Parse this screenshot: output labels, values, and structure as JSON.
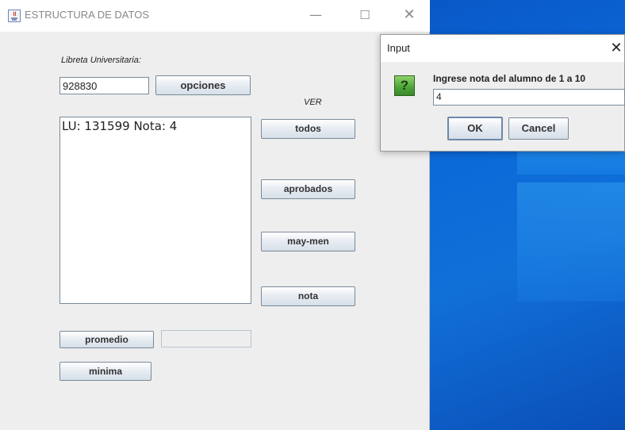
{
  "window": {
    "title": "ESTRUCTURA DE DATOS",
    "minimize_glyph": "—",
    "maximize_glyph": "☐",
    "close_glyph": "✕",
    "icon": "java-app-icon"
  },
  "form": {
    "libreta_label": "Libreta Universitaria:",
    "libreta_value": "928830",
    "opciones_label": "opciones",
    "ver_label": "VER",
    "output_text": "LU: 131599 Nota: 4",
    "todos_label": "todos",
    "aprobados_label": "aprobados",
    "maymen_label": "may-men",
    "nota_label": "nota",
    "promedio_label": "promedio",
    "promedio_value": "",
    "minima_label": "minima"
  },
  "dialog": {
    "title": "Input",
    "close_glyph": "✕",
    "icon": "question-icon",
    "icon_glyph": "?",
    "message": "Ingrese nota del alumno de 1 a 10",
    "input_value": "4",
    "ok_label": "OK",
    "cancel_label": "Cancel"
  },
  "colors": {
    "desktop_blue": "#0b6ad8",
    "window_bg": "#eeeeee",
    "question_icon_green": "#4ca236"
  }
}
